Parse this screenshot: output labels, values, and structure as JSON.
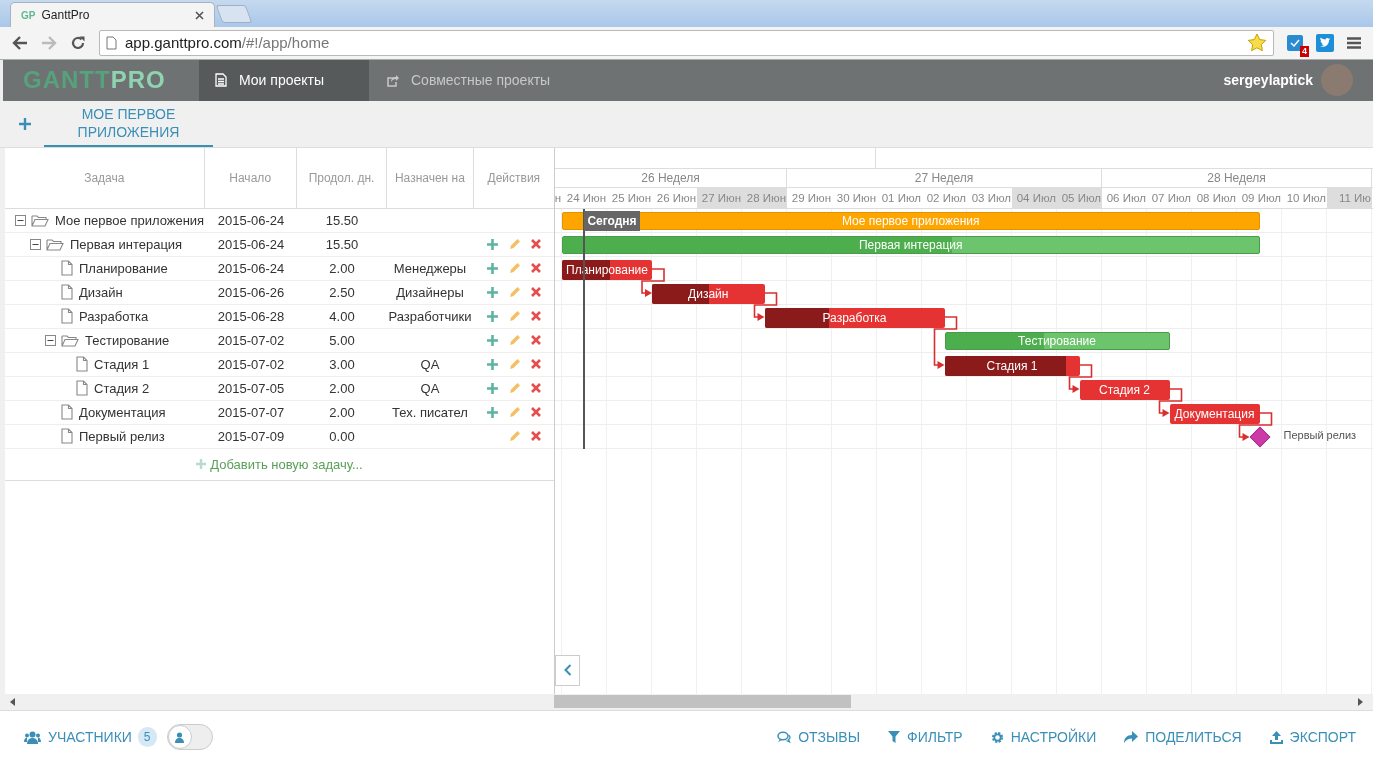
{
  "browser": {
    "tab_title": "GanttPro",
    "favicon": "GP",
    "url_host": "app.ganttpro.com",
    "url_path": "/#!/app/home",
    "extension_badge": "4"
  },
  "header": {
    "logo_left": "GANTT",
    "logo_right": "PRO",
    "tabs": [
      {
        "label": "Мои проекты",
        "selected": true
      },
      {
        "label": "Совместные проекты",
        "selected": false
      }
    ],
    "username": "sergeylaptick"
  },
  "project_tabs": [
    {
      "label": "МОЕ ПЕРВОЕ ПРИЛОЖЕНИЯ",
      "selected": true
    }
  ],
  "grid": {
    "columns": [
      "Задача",
      "Начало",
      "Продол. дн.",
      "Назначен на",
      "Действия"
    ],
    "rows": [
      {
        "name": "Мое первое приложения",
        "start": "2015-06-24",
        "duration": "15.50",
        "kind": "folder",
        "expanded": true,
        "add": false,
        "edit": false,
        "delete": false,
        "children": [
          {
            "name": "Первая интерация",
            "start": "2015-06-24",
            "duration": "15.50",
            "kind": "folder",
            "expanded": true,
            "add": true,
            "edit": true,
            "delete": true,
            "children": [
              {
                "name": "Планирование",
                "start": "2015-06-24",
                "duration": "2.00",
                "assignee": "Менеджеры",
                "kind": "file",
                "add": true,
                "edit": true,
                "delete": true
              },
              {
                "name": "Дизайн",
                "start": "2015-06-26",
                "duration": "2.50",
                "assignee": "Дизайнеры",
                "kind": "file",
                "add": true,
                "edit": true,
                "delete": true
              },
              {
                "name": "Разработка",
                "start": "2015-06-28",
                "duration": "4.00",
                "assignee": "Разработчики",
                "kind": "file",
                "add": true,
                "edit": true,
                "delete": true
              },
              {
                "name": "Тестирование",
                "start": "2015-07-02",
                "duration": "5.00",
                "kind": "folder",
                "expanded": true,
                "add": true,
                "edit": true,
                "delete": true,
                "children": [
                  {
                    "name": "Стадия 1",
                    "start": "2015-07-02",
                    "duration": "3.00",
                    "assignee": "QA",
                    "kind": "file",
                    "add": true,
                    "edit": true,
                    "delete": true
                  },
                  {
                    "name": "Стадия 2",
                    "start": "2015-07-05",
                    "duration": "2.00",
                    "assignee": "QA",
                    "kind": "file",
                    "add": true,
                    "edit": true,
                    "delete": true
                  }
                ]
              },
              {
                "name": "Документация",
                "start": "2015-07-07",
                "duration": "2.00",
                "assignee": "Тех. писател",
                "kind": "file",
                "add": true,
                "edit": true,
                "delete": true
              },
              {
                "name": "Первый релиз",
                "start": "2015-07-09",
                "duration": "0.00",
                "kind": "file",
                "add": false,
                "edit": true,
                "delete": true
              }
            ]
          }
        ]
      }
    ],
    "add_task": "Добавить новую задачу..."
  },
  "gantt": {
    "weeks": [
      "26 Неделя",
      "27 Неделя",
      "28 Неделя"
    ],
    "days": [
      {
        "label": "н",
        "weekend": false
      },
      {
        "label": "24 Июн",
        "weekend": false
      },
      {
        "label": "25 Июн",
        "weekend": false
      },
      {
        "label": "26 Июн",
        "weekend": false
      },
      {
        "label": "27 Июн",
        "weekend": true
      },
      {
        "label": "28 Июн",
        "weekend": true
      },
      {
        "label": "29 Июн",
        "weekend": false
      },
      {
        "label": "30 Июн",
        "weekend": false
      },
      {
        "label": "01 Июл",
        "weekend": false
      },
      {
        "label": "02 Июл",
        "weekend": false
      },
      {
        "label": "03 Июл",
        "weekend": false
      },
      {
        "label": "04 Июл",
        "weekend": true
      },
      {
        "label": "05 Июл",
        "weekend": true
      },
      {
        "label": "06 Июл",
        "weekend": false
      },
      {
        "label": "07 Июл",
        "weekend": false
      },
      {
        "label": "08 Июл",
        "weekend": false
      },
      {
        "label": "09 Июл",
        "weekend": false
      },
      {
        "label": "10 Июл",
        "weekend": false
      },
      {
        "label": "11 Ию",
        "weekend": true
      }
    ],
    "today_label": "Сегодня",
    "bars": [
      {
        "label": "Мое первое приложения",
        "kind": "project"
      },
      {
        "label": "Первая интерация",
        "kind": "group",
        "level": 0.56
      },
      {
        "label": "Планирование",
        "kind": "task",
        "level": 0.53
      },
      {
        "label": "Дизайн",
        "kind": "task",
        "level": 0.51
      },
      {
        "label": "Разработка",
        "kind": "task",
        "level": 0.36
      },
      {
        "label": "Тестирование",
        "kind": "group",
        "level": 0.44
      },
      {
        "label": "Стадия 1",
        "kind": "task",
        "level": 0.9
      },
      {
        "label": "Стадия 2",
        "kind": "task"
      },
      {
        "label": "Документация",
        "kind": "task"
      },
      {
        "label": "Первый релиз",
        "kind": "milestone"
      }
    ]
  },
  "footer": {
    "members_label": "УЧАСТНИКИ",
    "members_count": "5",
    "toggle_on": false,
    "links": [
      {
        "label": "ОТЗЫВЫ",
        "kind": "feedback"
      },
      {
        "label": "ФИЛЬТР",
        "kind": "filter"
      },
      {
        "label": "НАСТРОЙКИ",
        "kind": "settings"
      },
      {
        "label": "ПОДЕЛИТЬСЯ",
        "kind": "share"
      },
      {
        "label": "ЭКСПОРТ",
        "kind": "export"
      }
    ]
  }
}
